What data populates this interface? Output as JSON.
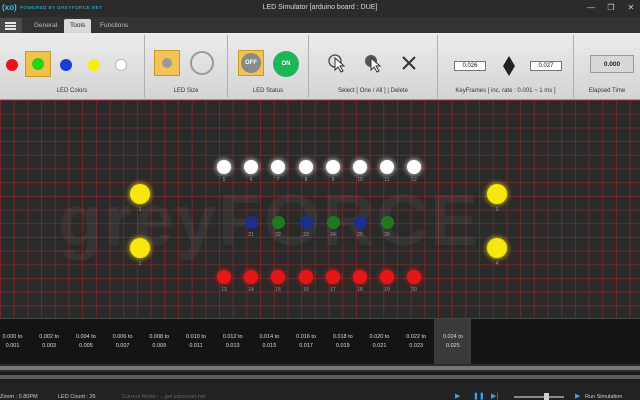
{
  "app": {
    "logo_text": "(xo)",
    "tagline": "POWERED BY GREYFORCE.NET",
    "title": "LED Simulator [arduino board : DUE]",
    "controls": {
      "minimize": "—",
      "restore": "❐",
      "close": "✕"
    }
  },
  "tabs": [
    {
      "label": "General",
      "active": false
    },
    {
      "label": "Tools",
      "active": true
    },
    {
      "label": "Functions",
      "active": false
    }
  ],
  "ribbon": {
    "led_colors": {
      "label": "LED Colors",
      "swatches": [
        {
          "name": "red",
          "color": "#e8131b"
        },
        {
          "name": "green",
          "color": "#26d40f"
        },
        {
          "name": "blue",
          "color": "#1d3ed6"
        },
        {
          "name": "yellow",
          "color": "#f6ef0c"
        },
        {
          "name": "white",
          "color": "#ffffff"
        }
      ],
      "selected": "green"
    },
    "led_size": {
      "label": "LED Size"
    },
    "led_status": {
      "label": "LED Status",
      "off": "OFF",
      "on": "ON"
    },
    "select": {
      "label": "Select [ One / All ] | Delete"
    },
    "keyframes": {
      "label": "KeyFrames [ inc. rate : 0.001 ~ 1 ms ]",
      "start": "0.026",
      "end": "0.027"
    },
    "elapsed": {
      "label": "Elapsed Time",
      "value": "0.000"
    }
  },
  "canvas": {
    "watermark": "greyFORCE",
    "colors": {
      "white": "#ffffff",
      "yellow": "#f7e70e",
      "blue": "#1b2f8c",
      "green": "#1f7a1f",
      "red": "#e51616"
    },
    "leds": [
      {
        "id": "1",
        "color": "yellow"
      },
      {
        "id": "2",
        "color": "yellow"
      },
      {
        "id": "3",
        "color": "yellow"
      },
      {
        "id": "4",
        "color": "yellow"
      },
      {
        "id": "5",
        "color": "white"
      },
      {
        "id": "6",
        "color": "white"
      },
      {
        "id": "7",
        "color": "white"
      },
      {
        "id": "8",
        "color": "white"
      },
      {
        "id": "9",
        "color": "white"
      },
      {
        "id": "10",
        "color": "white"
      },
      {
        "id": "11",
        "color": "white"
      },
      {
        "id": "12",
        "color": "white"
      },
      {
        "id": "21",
        "color": "blue"
      },
      {
        "id": "22",
        "color": "green"
      },
      {
        "id": "23",
        "color": "blue"
      },
      {
        "id": "24",
        "color": "green"
      },
      {
        "id": "25",
        "color": "blue"
      },
      {
        "id": "26",
        "color": "green"
      },
      {
        "id": "13",
        "color": "red"
      },
      {
        "id": "14",
        "color": "red"
      },
      {
        "id": "15",
        "color": "red"
      },
      {
        "id": "16",
        "color": "red"
      },
      {
        "id": "17",
        "color": "red"
      },
      {
        "id": "18",
        "color": "red"
      },
      {
        "id": "19",
        "color": "red"
      },
      {
        "id": "20",
        "color": "red"
      }
    ]
  },
  "timeline": {
    "keyframes": [
      {
        "from": "0.000 to",
        "to": "0.001"
      },
      {
        "from": "0.002 to",
        "to": "0.003"
      },
      {
        "from": "0.004 to",
        "to": "0.005"
      },
      {
        "from": "0.006 to",
        "to": "0.007"
      },
      {
        "from": "0.008 to",
        "to": "0.009"
      },
      {
        "from": "0.010 to",
        "to": "0.011"
      },
      {
        "from": "0.012 to",
        "to": "0.013"
      },
      {
        "from": "0.014 to",
        "to": "0.015"
      },
      {
        "from": "0.016 to",
        "to": "0.017"
      },
      {
        "from": "0.018 to",
        "to": "0.019"
      },
      {
        "from": "0.020 to",
        "to": "0.021"
      },
      {
        "from": "0.022 to",
        "to": "0.023"
      },
      {
        "from": "0.024 to",
        "to": "0.025"
      }
    ],
    "selected_index": 12
  },
  "status": {
    "zoom": "Zoom : 0.80PM",
    "led_count": "LED Count : 26",
    "current_mode": "Current Mode : ...get jobs/start.net",
    "media": {
      "play": "▶",
      "pause": "❚❚",
      "next": "▶|"
    },
    "run_simulation": "Run Simulation"
  }
}
